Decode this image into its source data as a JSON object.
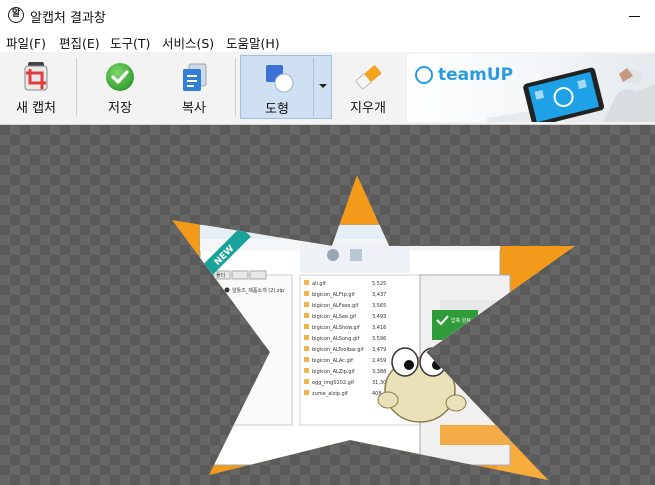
{
  "window": {
    "title": "알캡처 결과창",
    "app_icon_glyph": "알"
  },
  "menu": {
    "items": [
      "파일(F)",
      "편집(E)",
      "도구(T)",
      "서비스(S)",
      "도움말(H)"
    ]
  },
  "toolbar": {
    "new_capture": "새 캡처",
    "save": "저장",
    "copy": "복사",
    "shape": "도형",
    "eraser": "지우개"
  },
  "banner": {
    "brand": "teamUP"
  },
  "screenshot": {
    "new_badge": "NEW",
    "folder_tab": "폴더",
    "folder_label": "알툴즈_제품소개 (2).zip",
    "complete_text": "압축 완료",
    "files": [
      "all.gif",
      "bigicon_ALFtp.gif",
      "bigicon_ALFsee.gif",
      "bigicon_ALSee.gif",
      "bigicon_ALShow.gif",
      "bigicon_ALSong.gif",
      "bigicon_ALToolbar.gif",
      "bigicon_ALAc.gif",
      "bigicon_ALZip.gif",
      "egg_img0102.gif",
      "zume_alzip.gif"
    ],
    "sizes": [
      "5,525",
      "3,437",
      "3,565",
      "3,493",
      "3,416",
      "3,596",
      "3,479",
      "2,459",
      "3,388",
      "31,301",
      "408"
    ]
  },
  "colors": {
    "accent_orange": "#f39a1a",
    "save_green": "#3cae3c",
    "copy_blue": "#2f7fd9",
    "shape_blue": "#3a72d6",
    "canvas_dark": "#5a5a5a"
  },
  "icons": {
    "new_capture": "crop-frame-icon",
    "save": "check-circle-icon",
    "copy": "document-copy-icon",
    "shape": "shape-icon",
    "eraser": "eraser-icon"
  }
}
